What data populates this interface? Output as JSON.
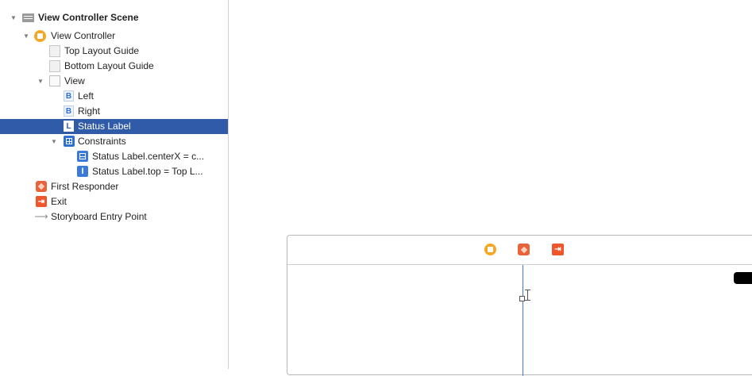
{
  "outline": {
    "items": [
      {
        "label": "View Controller Scene",
        "icon": "scene-icon"
      },
      {
        "label": "View Controller",
        "icon": "view-controller-icon"
      },
      {
        "label": "Top Layout Guide",
        "icon": "layout-guide-icon"
      },
      {
        "label": "Bottom Layout Guide",
        "icon": "layout-guide-icon"
      },
      {
        "label": "View",
        "icon": "view-icon"
      },
      {
        "label": "Left",
        "icon": "button-icon",
        "glyph": "B"
      },
      {
        "label": "Right",
        "icon": "button-icon",
        "glyph": "B"
      },
      {
        "label": "Status Label",
        "icon": "label-icon",
        "glyph": "L",
        "selected": true
      },
      {
        "label": "Constraints",
        "icon": "constraints-icon"
      },
      {
        "label": "Status Label.centerX = c...",
        "icon": "centerx-constraint-icon"
      },
      {
        "label": "Status Label.top = Top L...",
        "icon": "top-constraint-icon",
        "glyph": "I"
      },
      {
        "label": "First Responder",
        "icon": "first-responder-icon"
      },
      {
        "label": "Exit",
        "icon": "exit-icon",
        "glyph": "⇥"
      },
      {
        "label": "Storyboard Entry Point",
        "icon": "arrow-icon",
        "glyph": "⟶"
      }
    ],
    "disclosure_glyph": "▼"
  },
  "canvas": {
    "dock_icons": [
      "view-controller-icon",
      "first-responder-icon",
      "exit-icon"
    ],
    "exit_glyph": "⇥"
  },
  "colors": {
    "selection": "#2f5ba8",
    "view_controller": "#f5a623",
    "first_responder": "#e8623a",
    "exit": "#f0562c",
    "constraint": "#3b7ad9"
  }
}
